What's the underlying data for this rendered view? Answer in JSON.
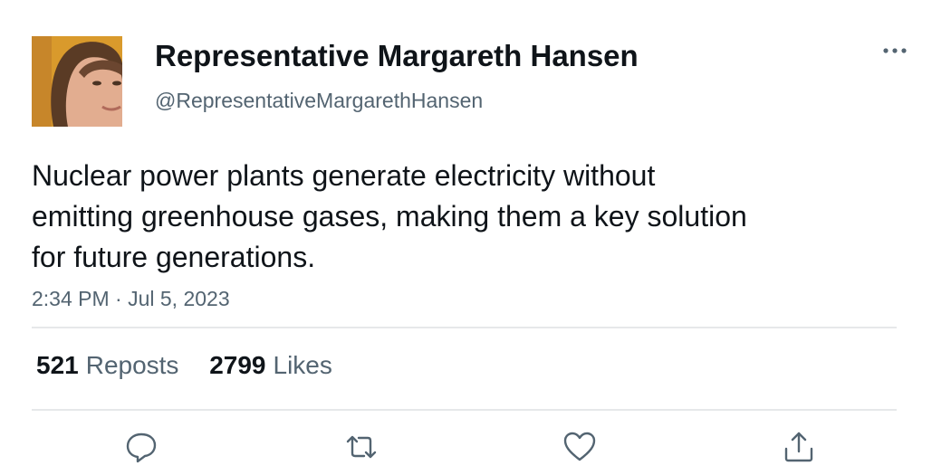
{
  "author": {
    "display_name": "Representative Margareth Hansen",
    "handle": "@RepresentativeMargarethHansen",
    "avatar_icon": "profile-photo"
  },
  "tweet": {
    "text_lines": [
      "Nuclear power plants generate electricity without",
      "emitting greenhouse gases, making them a key solution",
      "for future generations."
    ],
    "timestamp": "2:34 PM · Jul 5, 2023"
  },
  "stats": {
    "reposts_count": "521",
    "reposts_label": "Reposts",
    "likes_count": "2799",
    "likes_label": "Likes"
  },
  "actions": {
    "icons": [
      "reply-icon",
      "repost-icon",
      "like-icon",
      "share-icon"
    ]
  },
  "colors": {
    "text_primary": "#0f1419",
    "text_secondary": "#536471",
    "divider": "#e6e8ea",
    "icon": "#536471"
  }
}
